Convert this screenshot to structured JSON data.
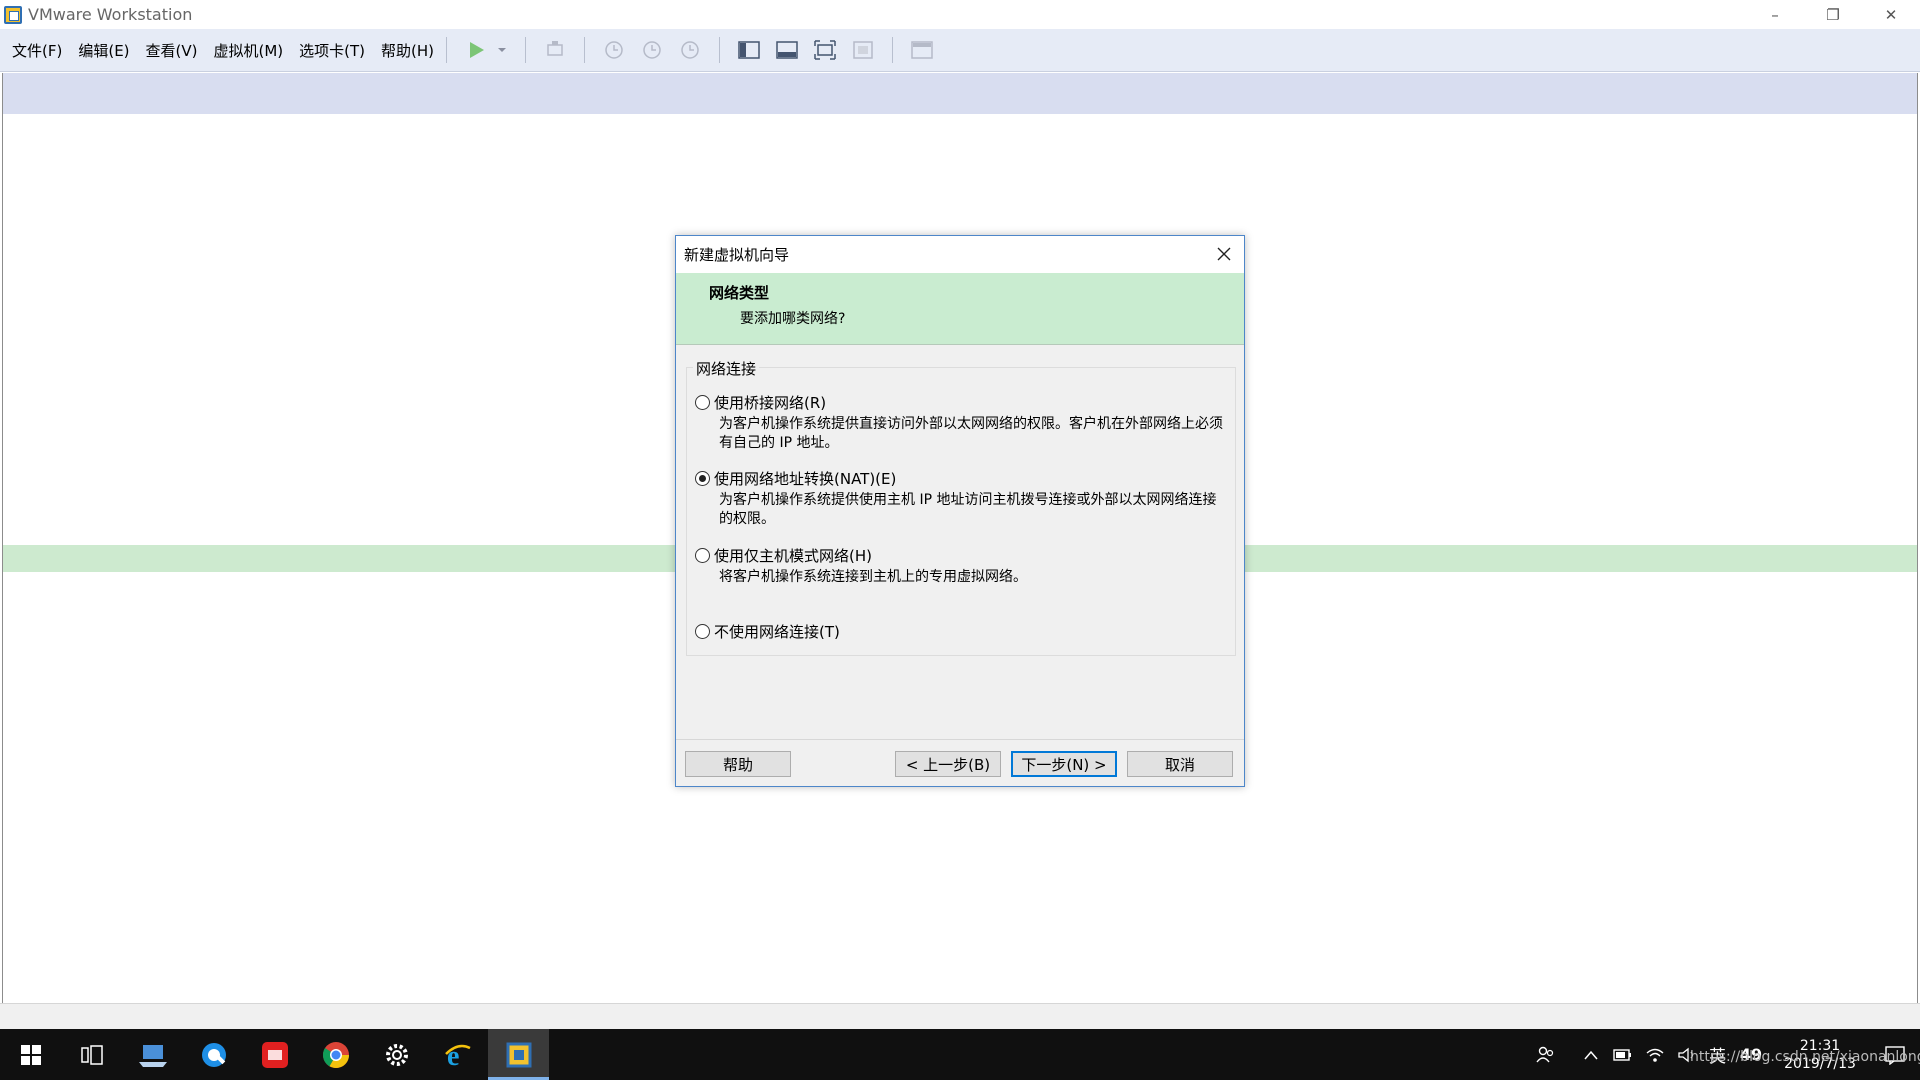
{
  "window": {
    "title": "VMware Workstation",
    "controls": {
      "minimize": "–",
      "restore": "❐",
      "close": "✕"
    }
  },
  "menu": {
    "items": [
      "文件(F)",
      "编辑(E)",
      "查看(V)",
      "虚拟机(M)",
      "选项卡(T)",
      "帮助(H)"
    ]
  },
  "toolbar": {
    "icons": [
      "play-icon",
      "dropdown-icon",
      "send-keys-icon",
      "snapshot-icon",
      "revert-snapshot-icon",
      "snapshot-manager-icon",
      "library-icon",
      "thumbnail-icon",
      "fullscreen-icon",
      "unity-icon",
      "console-icon"
    ]
  },
  "dialog": {
    "title": "新建虚拟机向导",
    "close_glyph": "✕",
    "header_title": "网络类型",
    "header_subtitle": "要添加哪类网络?",
    "group_label": "网络连接",
    "options": [
      {
        "label": "使用桥接网络(R)",
        "desc": "为客户机操作系统提供直接访问外部以太网网络的权限。客户机在外部网络上必须有自己的 IP 地址。",
        "checked": false
      },
      {
        "label": "使用网络地址转换(NAT)(E)",
        "desc": "为客户机操作系统提供使用主机 IP 地址访问主机拨号连接或外部以太网网络连接的权限。",
        "checked": true
      },
      {
        "label": "使用仅主机模式网络(H)",
        "desc": "将客户机操作系统连接到主机上的专用虚拟网络。",
        "checked": false
      },
      {
        "label": "不使用网络连接(T)",
        "desc": "",
        "checked": false
      }
    ],
    "buttons": {
      "help": "帮助",
      "back": "< 上一步(B)",
      "next": "下一步(N) >",
      "cancel": "取消"
    }
  },
  "taskbar": {
    "tray": {
      "lang": "英",
      "badge": "49"
    },
    "clock": {
      "time": "21:31",
      "date": "2019/7/13"
    }
  },
  "watermark": "https://blog.csdn.net/xiaonanlongjiong"
}
